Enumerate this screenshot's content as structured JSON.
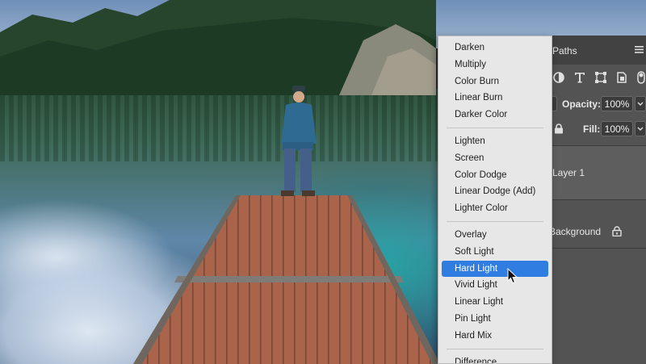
{
  "blend_menu": {
    "groups": [
      [
        "Darken",
        "Multiply",
        "Color Burn",
        "Linear Burn",
        "Darker Color"
      ],
      [
        "Lighten",
        "Screen",
        "Color Dodge",
        "Linear Dodge (Add)",
        "Lighter Color"
      ],
      [
        "Overlay",
        "Soft Light",
        "Hard Light",
        "Vivid Light",
        "Linear Light",
        "Pin Light",
        "Hard Mix"
      ],
      [
        "Difference"
      ]
    ],
    "selected": "Hard Light",
    "selection_color": "#2f7de1"
  },
  "panel": {
    "tab_label": "Paths",
    "opacity_label": "Opacity:",
    "opacity_value": "100%",
    "fill_label": "Fill:",
    "fill_value": "100%",
    "layers": [
      {
        "name": "Layer 1",
        "locked": false
      },
      {
        "name": "Background",
        "locked": true
      }
    ]
  }
}
